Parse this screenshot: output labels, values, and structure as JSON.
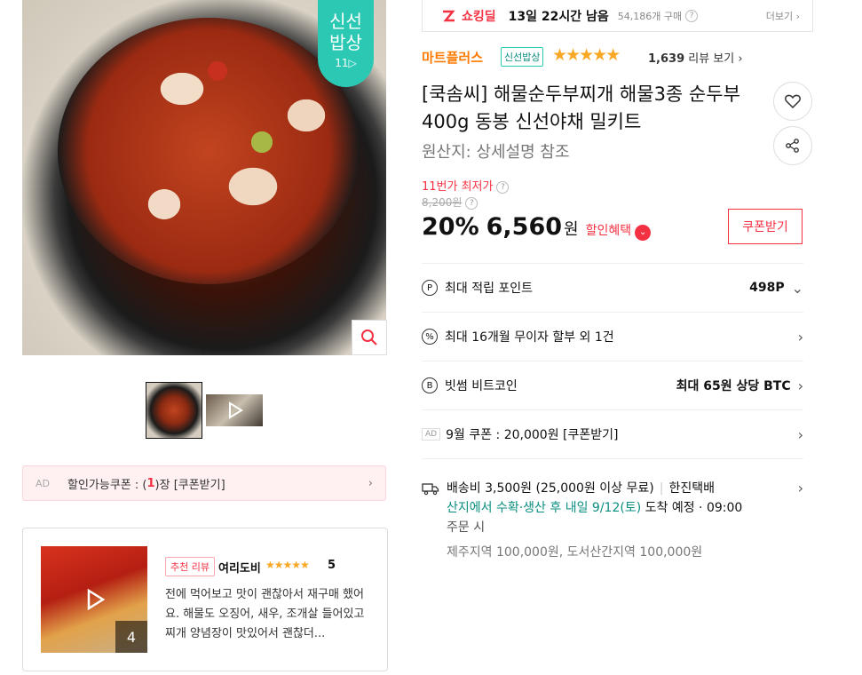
{
  "badge": {
    "line1": "신선",
    "line2": "밥상",
    "logo": "11▷"
  },
  "coupon_bar": {
    "ad": "AD",
    "prefix": "할인가능쿠폰 : (",
    "count": "1",
    "suffix": ")장 [쿠폰받기]"
  },
  "review": {
    "tag": "추천 리뷰",
    "user": "여리도비",
    "stars": "★★★★★",
    "score": "5",
    "text": "전에 먹어보고 맛이 괜찮아서 재구매 했어요. 해물도 오징어, 새우, 조개살 들어있고 찌개 양념장이 맛있어서 괜찮더...",
    "media_count": "4"
  },
  "deal": {
    "logo": "쇼킹딜",
    "time_left": "13일 22시간 남음",
    "sold": "54,186개 구매",
    "more": "더보기 ›"
  },
  "seller": {
    "name": "마트플러스",
    "badge": "신선밥상",
    "rating_stars": "★★★★★",
    "review_count": "1,639",
    "review_label": " 리뷰 보기 ›"
  },
  "product": {
    "title": "[쿡솜씨] 해물순두부찌개 해물3종 순두부 400g 동봉 신선야채 밀키트",
    "origin": "원산지:  상세설명 참조"
  },
  "price": {
    "lowest_label": "11번가 최저가",
    "original": "8,200원",
    "discount_rate": "20%",
    "sale_price": "6,560",
    "currency": "원",
    "benefit": "할인혜택",
    "coupon_button": "쿠폰받기"
  },
  "info_rows": {
    "points": {
      "icon": "P",
      "label": "최대 적립 포인트",
      "value": "498P",
      "chev": "⌄"
    },
    "installment": {
      "icon": "%",
      "label": "최대 16개월 무이자 할부 외 1건",
      "chev": "›"
    },
    "bitcoin": {
      "icon": "B",
      "label": "빗썸 비트코인",
      "value": "최대 65원 상당 BTC",
      "chev": "›"
    },
    "coupon": {
      "ad": "AD",
      "label": "9월 쿠폰 : 20,000원 [쿠폰받기]",
      "chev": "›"
    }
  },
  "shipping": {
    "fee": "배송비 3,500원 (25,000원 이상 무료)",
    "carrier": "한진택배",
    "arrival_green": "산지에서 수확·생산 후 내일 9/12(토)",
    "arrival_suffix": " 도착 예정  ·  09:00",
    "order_time": "주문 시",
    "extra_fee": "제주지역 100,000원, 도서산간지역 100,000원"
  },
  "colors": {
    "accent": "#f43142",
    "teal": "#2bc9b4",
    "seller": "#ff7a00",
    "star": "#f9a825"
  }
}
